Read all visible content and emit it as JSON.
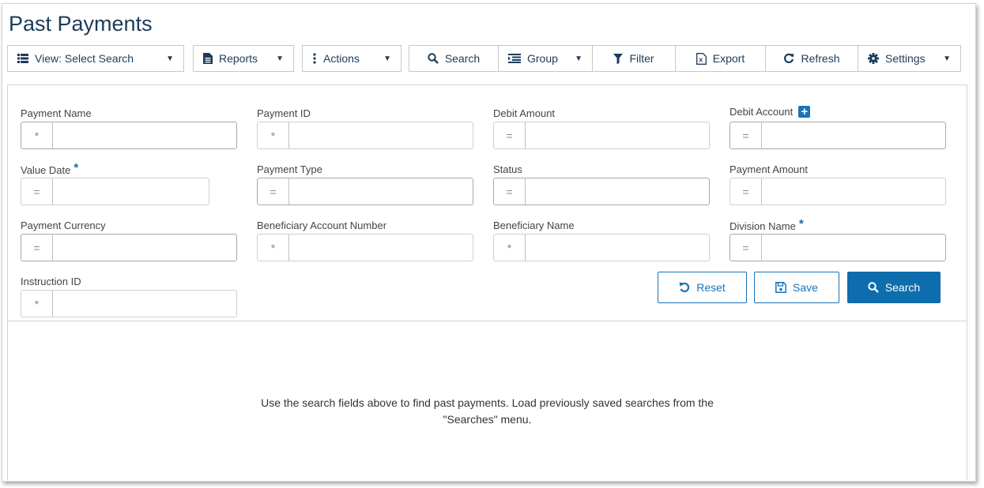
{
  "page": {
    "title": "Past Payments"
  },
  "toolbar": {
    "view_label": "View: Select Search",
    "reports_label": "Reports",
    "actions_label": "Actions",
    "search_label": "Search",
    "group_label": "Group",
    "filter_label": "Filter",
    "export_label": "Export",
    "refresh_label": "Refresh",
    "settings_label": "Settings"
  },
  "form": {
    "fields": [
      {
        "label": "Payment Name",
        "operator": "*",
        "value": ""
      },
      {
        "label": "Payment ID",
        "operator": "*",
        "value": ""
      },
      {
        "label": "Debit Amount",
        "operator": "=",
        "value": ""
      },
      {
        "label": "Debit Account",
        "operator": "=",
        "value": "",
        "has_add": true
      },
      {
        "label": "Value Date",
        "operator": "=",
        "value": "",
        "required": true
      },
      {
        "label": "Payment Type",
        "operator": "=",
        "value": ""
      },
      {
        "label": "Status",
        "operator": "=",
        "value": ""
      },
      {
        "label": "Payment Amount",
        "operator": "=",
        "value": ""
      },
      {
        "label": "Payment Currency",
        "operator": "=",
        "value": ""
      },
      {
        "label": "Beneficiary Account Number",
        "operator": "*",
        "value": ""
      },
      {
        "label": "Beneficiary Name",
        "operator": "*",
        "value": ""
      },
      {
        "label": "Division Name",
        "operator": "=",
        "value": "",
        "required": true
      },
      {
        "label": "Instruction ID",
        "operator": "*",
        "value": ""
      }
    ],
    "required_marker": "*",
    "add_marker": "+",
    "reset_label": "Reset",
    "save_label": "Save",
    "search_label": "Search"
  },
  "results": {
    "message_line1": "Use the search fields above to find past payments. Load previously saved searches from the",
    "message_line2": "\"Searches\" menu."
  },
  "icons": {
    "view": "list-icon",
    "reports": "document-icon",
    "actions": "vertical-dots-icon",
    "search": "magnifier-icon",
    "group": "group-list-icon",
    "filter": "funnel-icon",
    "export": "excel-file-icon",
    "refresh": "refresh-icon",
    "settings": "gear-icon",
    "reset": "undo-icon",
    "save": "floppy-disk-icon",
    "caret": "caret-down-icon"
  },
  "colors": {
    "title": "#1d3b58",
    "accent": "#1a73b8",
    "primary": "#0e6dad",
    "border": "#d3d3d3"
  }
}
